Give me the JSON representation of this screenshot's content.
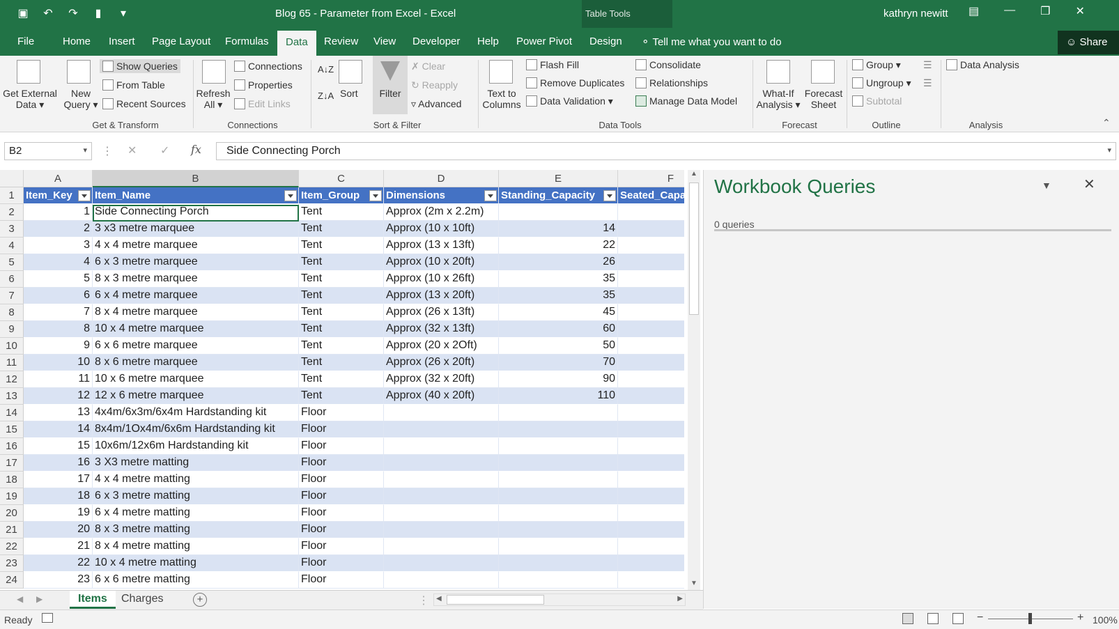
{
  "title_bar": {
    "title": "Blog 65 - Parameter from Excel  -  Excel",
    "table_tools": "Table Tools",
    "user": "kathryn newitt"
  },
  "tabs": [
    "File",
    "Home",
    "Insert",
    "Page Layout",
    "Formulas",
    "Data",
    "Review",
    "View",
    "Developer",
    "Help",
    "Power Pivot",
    "Design"
  ],
  "active_tab": "Data",
  "tell_me": "Tell me what you want to do",
  "share": "Share",
  "ribbon": {
    "get_external_1": "Get External",
    "get_external_2": "Data",
    "new_query_1": "New",
    "new_query_2": "Query",
    "show_queries": "Show Queries",
    "from_table": "From Table",
    "recent_sources": "Recent Sources",
    "refresh_1": "Refresh",
    "refresh_2": "All",
    "connections": "Connections",
    "properties": "Properties",
    "edit_links": "Edit Links",
    "sort": "Sort",
    "filter": "Filter",
    "clear": "Clear",
    "reapply": "Reapply",
    "advanced": "Advanced",
    "text_to_1": "Text to",
    "text_to_2": "Columns",
    "flash_fill": "Flash Fill",
    "remove_duplicates": "Remove Duplicates",
    "data_validation": "Data Validation",
    "consolidate": "Consolidate",
    "relationships": "Relationships",
    "manage_data_model": "Manage Data Model",
    "what_if_1": "What-If",
    "what_if_2": "Analysis",
    "forecast_1": "Forecast",
    "forecast_2": "Sheet",
    "group": "Group",
    "ungroup": "Ungroup",
    "subtotal": "Subtotal",
    "data_analysis": "Data Analysis",
    "groups": {
      "get_transform": "Get & Transform",
      "connections": "Connections",
      "sort_filter": "Sort & Filter",
      "data_tools": "Data Tools",
      "forecast": "Forecast",
      "outline": "Outline",
      "analysis": "Analysis"
    }
  },
  "formula_bar": {
    "name_box": "B2",
    "fx": "fx",
    "value": "Side Connecting Porch"
  },
  "columns": [
    "A",
    "B",
    "C",
    "D",
    "E",
    "F"
  ],
  "table": {
    "headers": [
      "Item_Key",
      "Item_Name",
      "Item_Group",
      "Dimensions",
      "Standing_Capacity",
      "Seated_Capa"
    ],
    "rows": [
      {
        "n": "2",
        "key": "1",
        "name": "Side Connecting Porch",
        "group": "Tent",
        "dim": " Approx (2m x 2.2m)",
        "cap": ""
      },
      {
        "n": "3",
        "key": "2",
        "name": "3 x3 metre marquee",
        "group": "Tent",
        "dim": "Approx (10 x 10ft)",
        "cap": "14"
      },
      {
        "n": "4",
        "key": "3",
        "name": "4 x 4 metre marquee",
        "group": "Tent",
        "dim": "Approx (13 x 13ft)",
        "cap": "22"
      },
      {
        "n": "5",
        "key": "4",
        "name": "6 x 3 metre marquee",
        "group": "Tent",
        "dim": "Approx (10 x 20ft)",
        "cap": "26"
      },
      {
        "n": "6",
        "key": "5",
        "name": "8 x 3 metre marquee",
        "group": "Tent",
        "dim": "Approx (10 x 26ft)",
        "cap": "35"
      },
      {
        "n": "7",
        "key": "6",
        "name": "6 x 4 metre marquee",
        "group": "Tent",
        "dim": "Approx (13 x 20ft)",
        "cap": "35"
      },
      {
        "n": "8",
        "key": "7",
        "name": "8 x 4 metre marquee",
        "group": "Tent",
        "dim": "Approx (26 x 13ft)",
        "cap": "45"
      },
      {
        "n": "9",
        "key": "8",
        "name": "10 x 4 metre marquee",
        "group": "Tent",
        "dim": "Approx (32 x 13ft)",
        "cap": "60"
      },
      {
        "n": "10",
        "key": "9",
        "name": "6 x 6 metre marquee",
        "group": "Tent",
        "dim": "Approx (20 x 2Oft)",
        "cap": "50"
      },
      {
        "n": "11",
        "key": "10",
        "name": "8 x 6 metre marquee",
        "group": "Tent",
        "dim": "Approx (26 x 20ft)",
        "cap": "70"
      },
      {
        "n": "12",
        "key": "11",
        "name": "10 x 6 metre marquee",
        "group": "Tent",
        "dim": "Approx (32 x 20ft)",
        "cap": "90"
      },
      {
        "n": "13",
        "key": "12",
        "name": "12 x 6 metre marquee",
        "group": "Tent",
        "dim": "Approx (40 x 20ft)",
        "cap": "110"
      },
      {
        "n": "14",
        "key": "13",
        "name": "4x4m/6x3m/6x4m Hardstanding kit",
        "group": "Floor",
        "dim": "",
        "cap": ""
      },
      {
        "n": "15",
        "key": "14",
        "name": "8x4m/1Ox4m/6x6m Hardstanding kit",
        "group": "Floor",
        "dim": "",
        "cap": ""
      },
      {
        "n": "16",
        "key": "15",
        "name": "10x6m/12x6m Hardstanding kit",
        "group": "Floor",
        "dim": "",
        "cap": ""
      },
      {
        "n": "17",
        "key": "16",
        "name": "3 X3 metre matting",
        "group": "Floor",
        "dim": "",
        "cap": ""
      },
      {
        "n": "18",
        "key": "17",
        "name": "4 x 4 metre matting",
        "group": "Floor",
        "dim": "",
        "cap": ""
      },
      {
        "n": "19",
        "key": "18",
        "name": "6 x 3 metre matting",
        "group": "Floor",
        "dim": "",
        "cap": ""
      },
      {
        "n": "20",
        "key": "19",
        "name": "6 x 4 metre matting",
        "group": "Floor",
        "dim": "",
        "cap": ""
      },
      {
        "n": "21",
        "key": "20",
        "name": "8 x 3 metre matting",
        "group": "Floor",
        "dim": "",
        "cap": ""
      },
      {
        "n": "22",
        "key": "21",
        "name": "8 x 4 metre matting",
        "group": "Floor",
        "dim": "",
        "cap": ""
      },
      {
        "n": "23",
        "key": "22",
        "name": "10 x 4 metre matting",
        "group": "Floor",
        "dim": "",
        "cap": ""
      },
      {
        "n": "24",
        "key": "23",
        "name": "6 x 6 metre matting",
        "group": "Floor",
        "dim": "",
        "cap": ""
      }
    ]
  },
  "pane": {
    "title": "Workbook Queries",
    "count": "0 queries"
  },
  "sheets": [
    "Items",
    "Charges"
  ],
  "active_sheet": "Items",
  "status": {
    "ready": "Ready",
    "zoom": "100%"
  }
}
